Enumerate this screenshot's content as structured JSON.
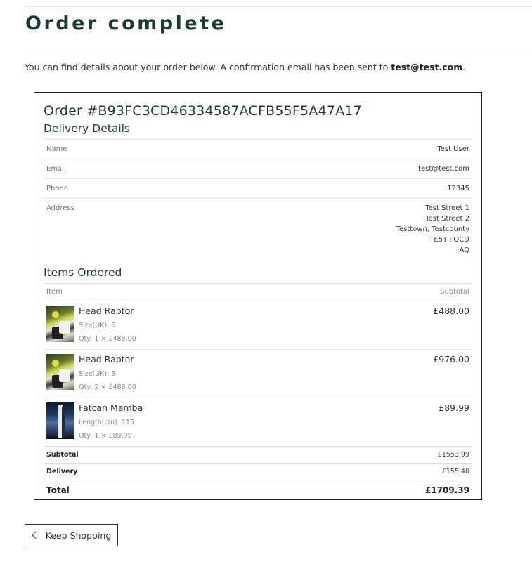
{
  "page": {
    "title": "Order complete",
    "intro_text": "You can find details about your order below. A confirmation email has been sent to ",
    "intro_email": "test@test.com",
    "intro_end": "."
  },
  "order": {
    "heading": "Order #B93FC3CD46334587ACFB55F5A47A17",
    "delivery_heading": "Delivery Details",
    "delivery": {
      "name_label": "Name",
      "name": "Test User",
      "email_label": "Email",
      "email": "test@test.com",
      "phone_label": "Phone",
      "phone": "12345",
      "address_label": "Address",
      "address_lines": [
        "Test Street 1",
        "Test Street 2",
        "Testtown, Testcounty",
        "TE5T POCD",
        "AQ"
      ]
    },
    "items_heading": "Items Ordered",
    "items_header": {
      "item": "Item",
      "subtotal": "Subtotal"
    },
    "items": [
      {
        "name": "Head Raptor",
        "option": "Size(UK): 6",
        "qty": "Qty: 1 × £488.00",
        "subtotal": "£488.00",
        "thumb": "raptor"
      },
      {
        "name": "Head Raptor",
        "option": "Size(UK): 3",
        "qty": "Qty: 2 × £488.00",
        "subtotal": "£976.00",
        "thumb": "raptor"
      },
      {
        "name": "Fatcan Mamba",
        "option": "Length(cm): 115",
        "qty": "Qty: 1 × £89.99",
        "subtotal": "£89.99",
        "thumb": "mamba"
      }
    ],
    "totals": {
      "subtotal_label": "Subtotal",
      "subtotal": "£1553.99",
      "delivery_label": "Delivery",
      "delivery": "£155.40",
      "total_label": "Total",
      "total": "£1709.39"
    }
  },
  "actions": {
    "keep_shopping": "Keep Shopping",
    "keep_shopping_icon": "chevron-left-icon"
  }
}
